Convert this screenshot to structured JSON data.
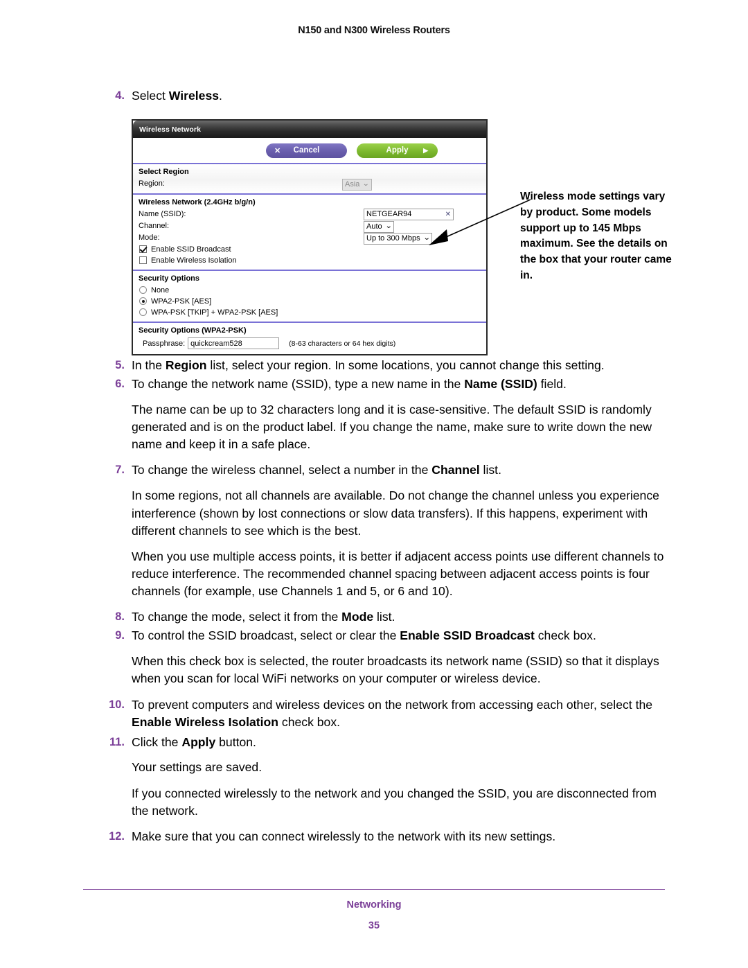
{
  "header": {
    "running_title": "N150 and N300 Wireless Routers"
  },
  "steps": [
    {
      "num": "4.",
      "html": "Select <b>Wireless</b>."
    },
    {
      "num": "5.",
      "html": "In the <b>Region</b> list, select your region. In some locations, you cannot change this setting."
    },
    {
      "num": "6.",
      "html": "To change the network name (SSID), type a new name in the <b>Name (SSID)</b> field."
    },
    {
      "num": "7.",
      "html": "To change the wireless channel, select a number in the <b>Channel</b> list."
    },
    {
      "num": "8.",
      "html": "To change the mode, select it from the <b>Mode</b> list."
    },
    {
      "num": "9.",
      "html": "To control the SSID broadcast, select or clear the <b>Enable SSID Broadcast</b> check box."
    },
    {
      "num": "10.",
      "html": "To prevent computers and wireless devices on the network from accessing each other, select the <b>Enable Wireless Isolation</b> check box."
    },
    {
      "num": "11.",
      "html": "Click the <b>Apply</b> button."
    },
    {
      "num": "12.",
      "html": "Make sure that you can connect wirelessly to the network with its new settings."
    }
  ],
  "paragraphs": {
    "ssid_name_info": "The name can be up to 32 characters long and it is case-sensitive. The default SSID is randomly generated and is on the product label. If you change the name, make sure to write down the new name and keep it in a safe place.",
    "channel_info_1": "In some regions, not all channels are available. Do not change the channel unless you experience interference (shown by lost connections or slow data transfers). If this happens, experiment with different channels to see which is the best.",
    "channel_info_2": "When you use multiple access points, it is better if adjacent access points use different channels to reduce interference. The recommended channel spacing between adjacent access points is four channels (for example, use Channels 1 and 5, or 6 and 10).",
    "ssid_broadcast_info": "When this check box is selected, the router broadcasts its network name (SSID) so that it displays when you scan for local WiFi networks on your computer or wireless device.",
    "settings_saved": "Your settings are saved.",
    "disconnect_info": "If you connected wirelessly to the network and you changed the SSID, you are disconnected from the network."
  },
  "callout": {
    "text": "Wireless mode settings vary by product. Some models support up to 145 Mbps maximum. See the details on the box that your router came in."
  },
  "router_panel": {
    "title": "Wireless Network",
    "buttons": {
      "cancel_label": "Cancel",
      "cancel_glyph": "✕",
      "apply_label": "Apply",
      "apply_glyph": "▶"
    },
    "region_section": {
      "title": "Select Region",
      "region_label": "Region:",
      "region_value": "Asia",
      "region_disabled": true
    },
    "wireless_section": {
      "title": "Wireless Network (2.4GHz b/g/n)",
      "ssid_label": "Name (SSID):",
      "ssid_value": "NETGEAR94",
      "ssid_clear_glyph": "✕",
      "channel_label": "Channel:",
      "channel_value": "Auto",
      "mode_label": "Mode:",
      "mode_value": "Up to 300 Mbps",
      "ssid_broadcast_label": "Enable SSID Broadcast",
      "ssid_broadcast_checked": true,
      "wireless_isolation_label": "Enable Wireless Isolation",
      "wireless_isolation_checked": false
    },
    "security_section": {
      "title": "Security Options",
      "options": [
        {
          "label": "None",
          "selected": false
        },
        {
          "label": "WPA2-PSK [AES]",
          "selected": true
        },
        {
          "label": "WPA-PSK [TKIP] + WPA2-PSK [AES]",
          "selected": false
        }
      ]
    },
    "passphrase_section": {
      "title": "Security Options (WPA2-PSK)",
      "passphrase_label": "Passphrase:",
      "passphrase_value": "quickcream528",
      "hint": "(8-63 characters or 64 hex digits)"
    }
  },
  "footer": {
    "chapter": "Networking",
    "page_number": "35"
  },
  "colors": {
    "accent_purple": "#7b3f98",
    "separator_violet": "#7a72d6",
    "cancel_button": "#6a5fae",
    "apply_button": "#7cb82e"
  }
}
